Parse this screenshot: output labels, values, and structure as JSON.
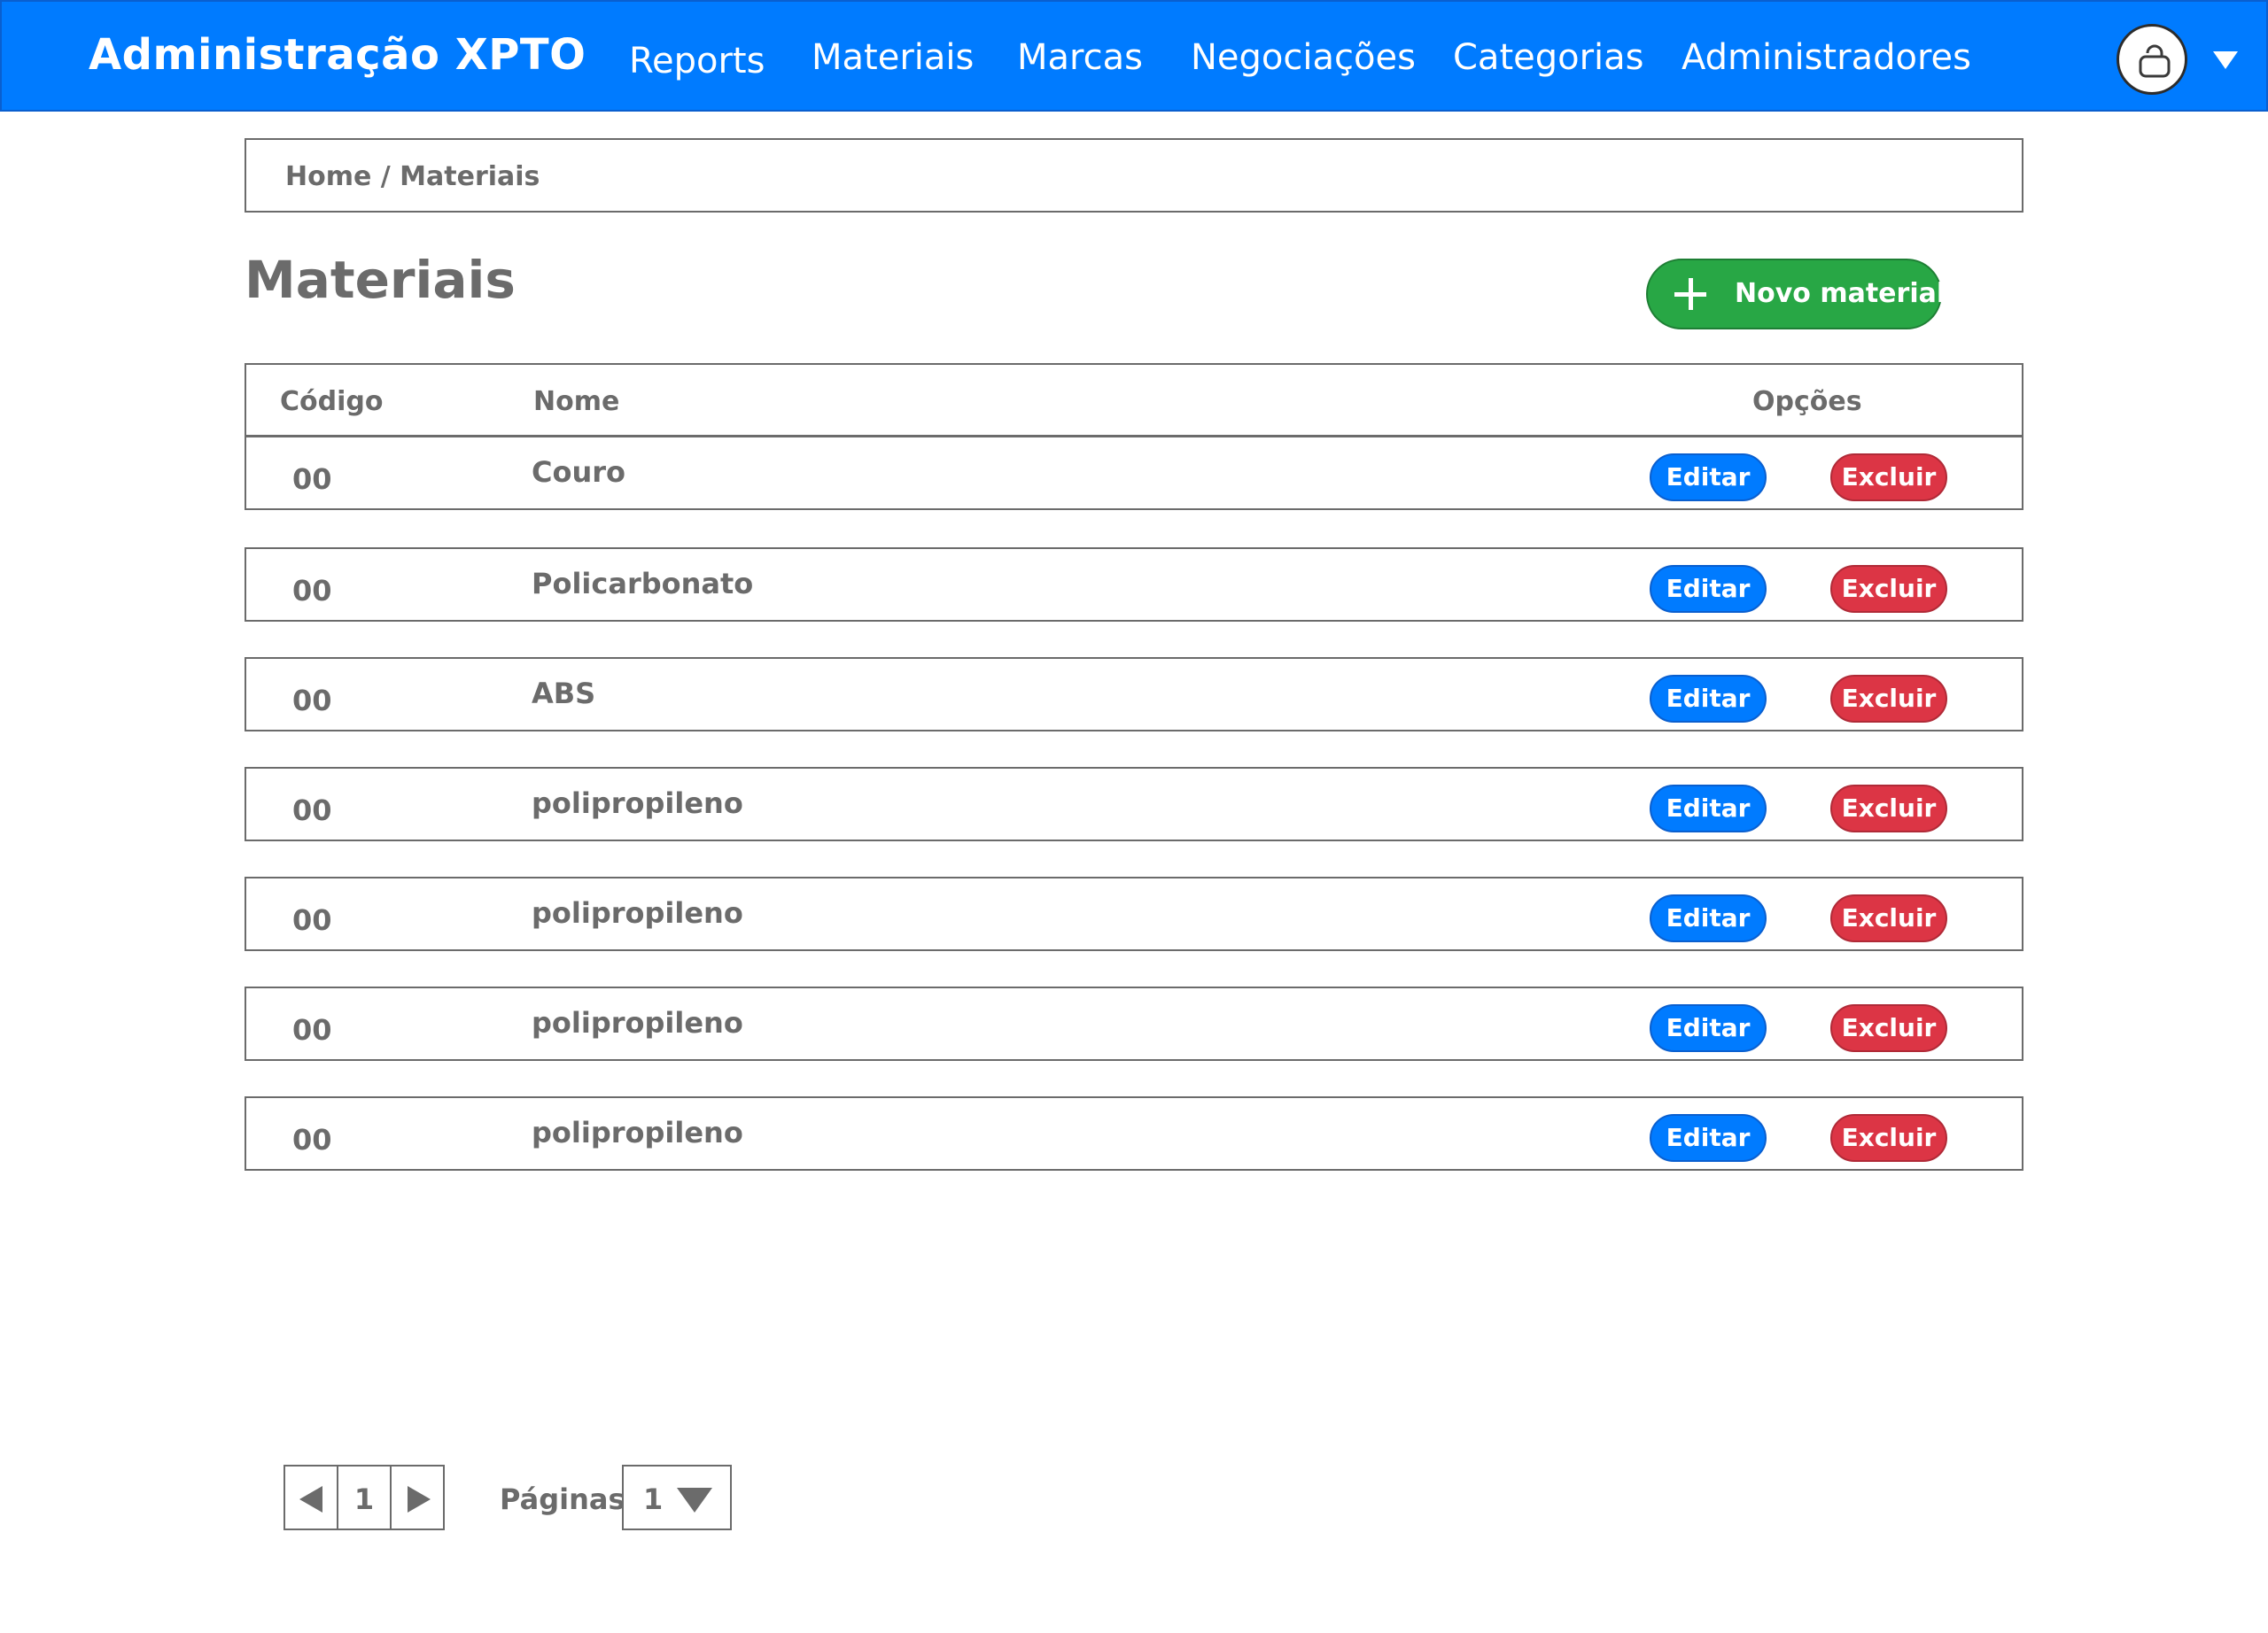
{
  "header": {
    "brand": "Administração XPTO",
    "nav": [
      "Reports",
      "Materiais",
      "Marcas",
      "Negociações",
      "Categorias",
      "Administradores"
    ],
    "avatar_icon": "user-icon",
    "menu_icon": "caret-down-icon",
    "color": "#007bff"
  },
  "breadcrumb": "Home / Materiais",
  "page": {
    "title": "Materiais",
    "new_button": "Novo material",
    "new_button_icon": "plus-icon"
  },
  "table": {
    "headers": {
      "code": "Código",
      "name": "Nome",
      "options": "Opções"
    },
    "rows": [
      {
        "code": "00",
        "name": "Couro"
      },
      {
        "code": "00",
        "name": "Policarbonato"
      },
      {
        "code": "00",
        "name": "ABS"
      },
      {
        "code": "00",
        "name": "polipropileno"
      },
      {
        "code": "00",
        "name": "polipropileno"
      },
      {
        "code": "00",
        "name": "polipropileno"
      },
      {
        "code": "00",
        "name": "polipropileno"
      }
    ],
    "edit_label": "Editar",
    "delete_label": "Excluir",
    "colors": {
      "edit": "#007bff",
      "delete": "#dc3545",
      "new": "#28a745"
    }
  },
  "pagination": {
    "current_page": "1",
    "pages_label": "Páginas",
    "pages_value": "1"
  }
}
